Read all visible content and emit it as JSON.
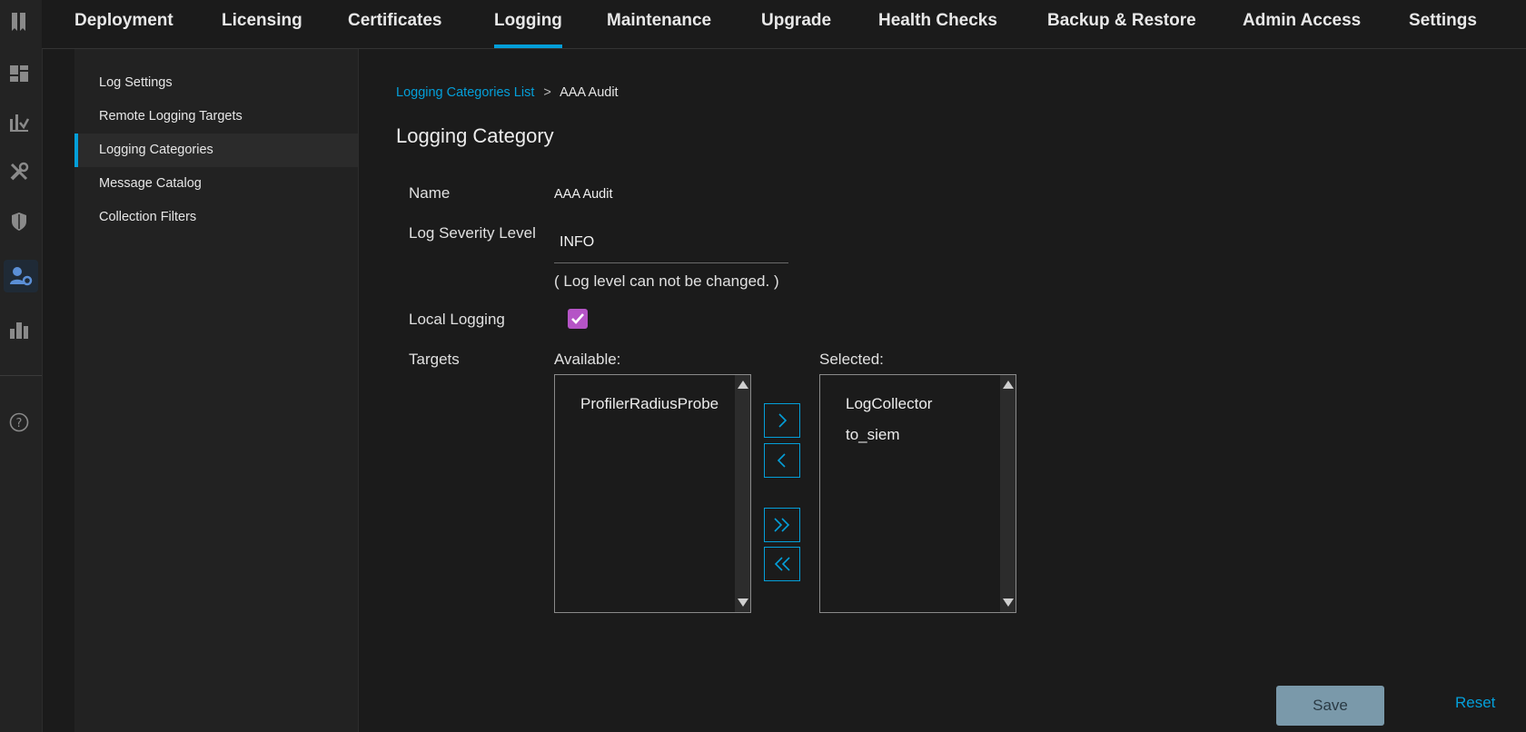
{
  "rail": {
    "icons": [
      "bookmark-icon",
      "dashboard-icon",
      "analytics-icon",
      "tools-icon",
      "shield-icon",
      "admin-user-icon",
      "work-centers-icon",
      "help-icon"
    ]
  },
  "topnav": {
    "tabs": [
      "Deployment",
      "Licensing",
      "Certificates",
      "Logging",
      "Maintenance",
      "Upgrade",
      "Health Checks",
      "Backup & Restore",
      "Admin Access",
      "Settings"
    ],
    "active": "Logging"
  },
  "subnav": {
    "items": [
      "Log Settings",
      "Remote Logging Targets",
      "Logging Categories",
      "Message Catalog",
      "Collection Filters"
    ],
    "active": "Logging Categories"
  },
  "breadcrumb": {
    "parent": "Logging Categories List",
    "separator": ">",
    "current": "AAA Audit"
  },
  "page_title": "Logging Category",
  "form": {
    "name_label": "Name",
    "name_value": "AAA Audit",
    "severity_label": "Log Severity Level",
    "severity_value": "INFO",
    "severity_note": "( Log level can not be changed. )",
    "local_logging_label": "Local Logging",
    "local_logging_checked": true,
    "targets_label": "Targets",
    "available_label": "Available:",
    "selected_label": "Selected:",
    "available_items": [
      "ProfilerRadiusProbe"
    ],
    "selected_items": [
      "LogCollector",
      "to_siem"
    ]
  },
  "actions": {
    "save_label": "Save",
    "reset_label": "Reset"
  },
  "colors": {
    "accent": "#049fd9",
    "checkbox": "#b554c6",
    "background": "#1b1b1b"
  }
}
